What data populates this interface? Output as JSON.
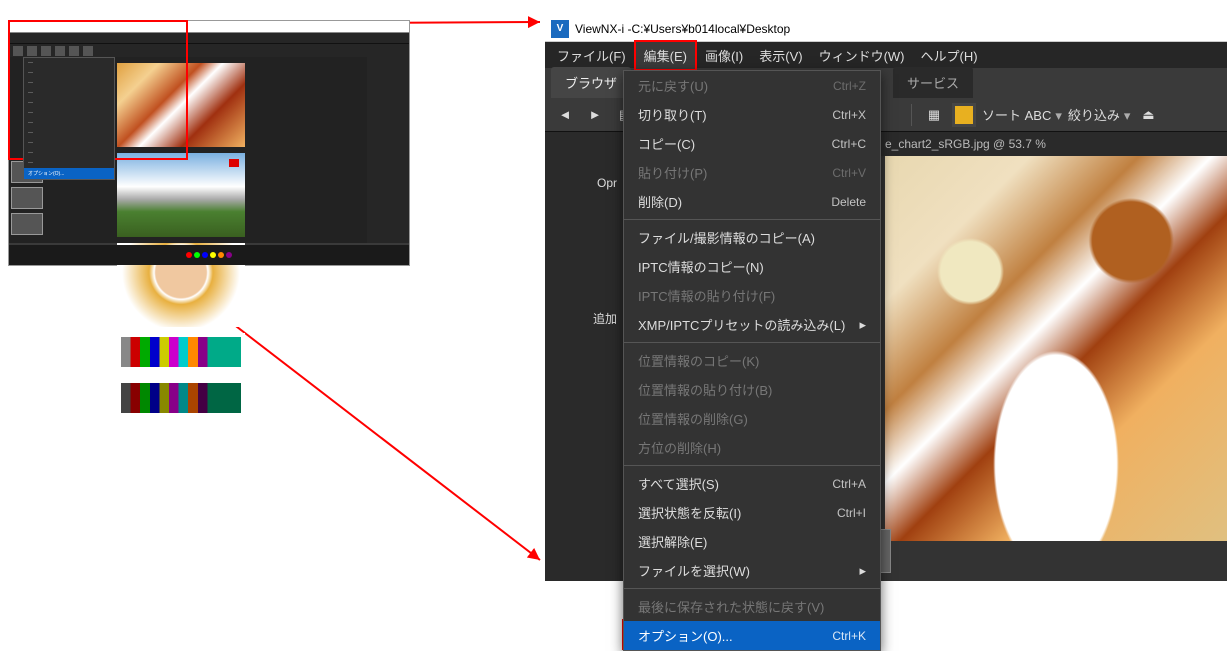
{
  "thumb": {
    "menu_highlight": "オプション(O)..."
  },
  "main": {
    "title_prefix": "ViewNX-i  -  ",
    "title_path": "C:¥Users¥b014local¥Desktop",
    "menubar": [
      {
        "label": "ファイル(F)"
      },
      {
        "label": "編集(E)",
        "active": true
      },
      {
        "label": "画像(I)"
      },
      {
        "label": "表示(V)"
      },
      {
        "label": "ウィンドウ(W)"
      },
      {
        "label": "ヘルプ(H)"
      }
    ],
    "tabs": {
      "primary": "ブラウザ",
      "secondary": "サービス"
    },
    "toolbar": {
      "sort_label": "ソート ABC",
      "filter_label": "絞り込み"
    },
    "pathbar": "e_chart2_sRGB.jpg @ 53.7 %",
    "left_labels": {
      "label1": "Opr",
      "label2": "追加"
    }
  },
  "dropdown": {
    "items": [
      {
        "label": "元に戻す(U)",
        "shortcut": "Ctrl+Z",
        "disabled": true
      },
      {
        "label": "切り取り(T)",
        "shortcut": "Ctrl+X"
      },
      {
        "label": "コピー(C)",
        "shortcut": "Ctrl+C"
      },
      {
        "label": "貼り付け(P)",
        "shortcut": "Ctrl+V",
        "disabled": true
      },
      {
        "label": "削除(D)",
        "shortcut": "Delete"
      },
      {
        "sep": true
      },
      {
        "label": "ファイル/撮影情報のコピー(A)"
      },
      {
        "label": "IPTC情報のコピー(N)"
      },
      {
        "label": "IPTC情報の貼り付け(F)",
        "disabled": true
      },
      {
        "label": "XMP/IPTCプリセットの読み込み(L)",
        "submenu": true
      },
      {
        "sep": true
      },
      {
        "label": "位置情報のコピー(K)",
        "disabled": true
      },
      {
        "label": "位置情報の貼り付け(B)",
        "disabled": true
      },
      {
        "label": "位置情報の削除(G)",
        "disabled": true
      },
      {
        "label": "方位の削除(H)",
        "disabled": true
      },
      {
        "sep": true
      },
      {
        "label": "すべて選択(S)",
        "shortcut": "Ctrl+A"
      },
      {
        "label": "選択状態を反転(I)",
        "shortcut": "Ctrl+I"
      },
      {
        "label": "選択解除(E)"
      },
      {
        "label": "ファイルを選択(W)",
        "submenu": true
      },
      {
        "sep": true
      },
      {
        "label": "最後に保存された状態に戻す(V)",
        "disabled": true
      },
      {
        "label": "オプション(O)...",
        "shortcut": "Ctrl+K",
        "selected": true
      }
    ]
  }
}
